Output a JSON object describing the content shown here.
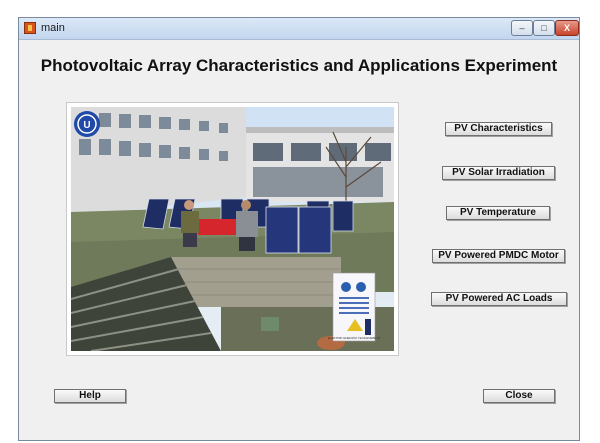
{
  "window": {
    "title": "main",
    "controls": {
      "minimize": "–",
      "maximize": "□",
      "close": "X"
    }
  },
  "heading": "Photovoltaic Array Characteristics and Applications Experiment",
  "photo": {
    "sign_text": "ELEKTRİK ENERJİSİ YENİLENEBİLİR",
    "logo_text": "U"
  },
  "buttons": {
    "pv_characteristics": "PV Characteristics",
    "pv_solar_irradiation": "PV Solar Irradiation",
    "pv_temperature": "PV Temperature",
    "pv_powered_pmdc_motor": "PV Powered PMDC Motor",
    "pv_powered_ac_loads": "PV Powered AC Loads",
    "help": "Help",
    "close": "Close"
  }
}
